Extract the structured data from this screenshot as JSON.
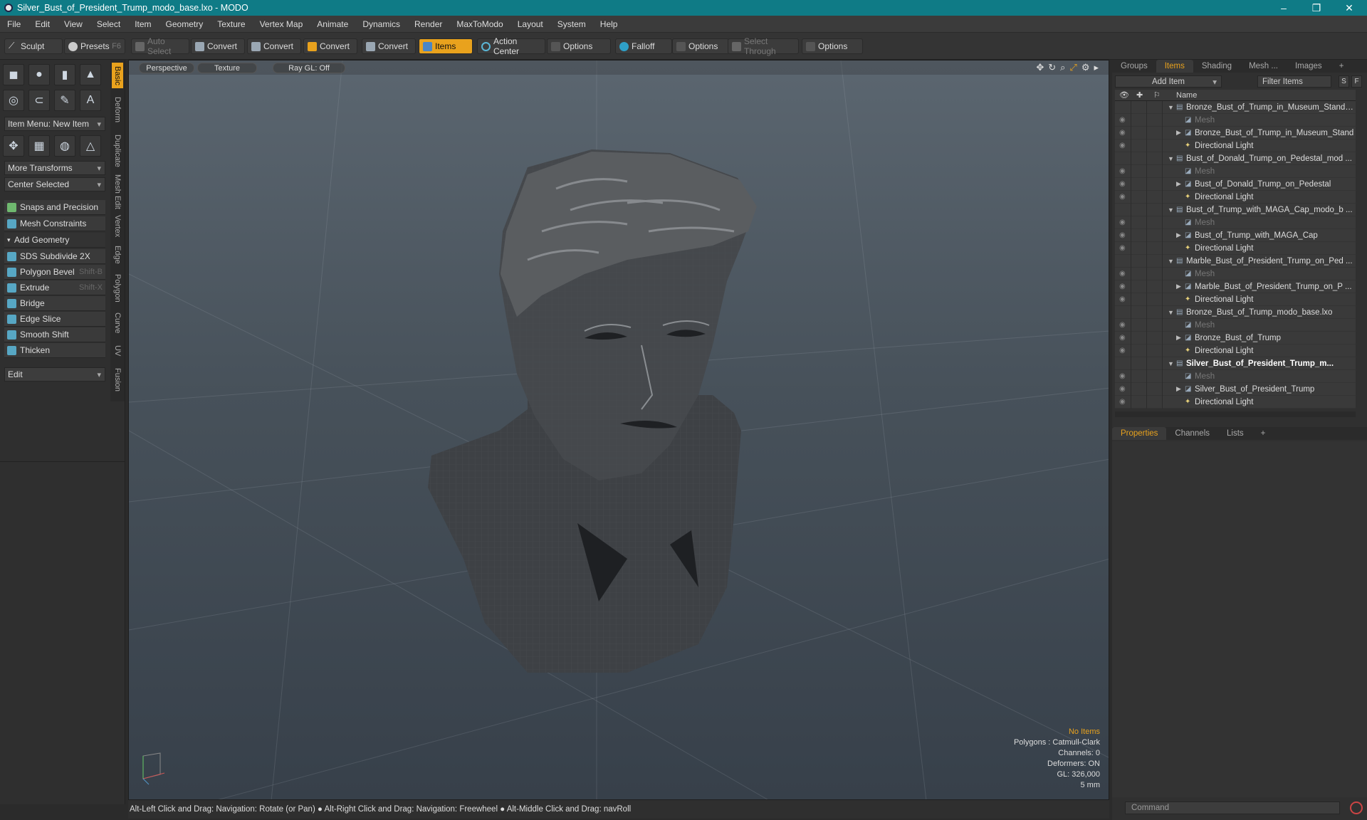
{
  "window": {
    "title": "Silver_Bust_of_President_Trump_modo_base.lxo - MODO"
  },
  "menu": [
    "File",
    "Edit",
    "View",
    "Select",
    "Item",
    "Geometry",
    "Texture",
    "Vertex Map",
    "Animate",
    "Dynamics",
    "Render",
    "MaxToModo",
    "Layout",
    "System",
    "Help"
  ],
  "toolbar": {
    "sculpt": "Sculpt",
    "presets": "Presets",
    "presets_shortcut": "F6",
    "auto_select": "Auto Select",
    "convert1": "Convert",
    "convert2": "Convert",
    "convert3": "Convert",
    "convert4": "Convert",
    "items": "Items",
    "action_center": "Action Center",
    "options1": "Options",
    "falloff": "Falloff",
    "options2": "Options",
    "select_through": "Select Through",
    "options3": "Options"
  },
  "left": {
    "item_menu": "Item Menu: New Item",
    "more_transforms": "More Transforms",
    "center_selected": "Center Selected",
    "snaps": "Snaps and Precision",
    "mesh_constraints": "Mesh Constraints",
    "add_geometry": "Add Geometry",
    "tools": [
      {
        "label": "SDS Subdivide 2X",
        "shortcut": ""
      },
      {
        "label": "Polygon Bevel",
        "shortcut": "Shift-B"
      },
      {
        "label": "Extrude",
        "shortcut": "Shift-X"
      },
      {
        "label": "Bridge",
        "shortcut": ""
      },
      {
        "label": "Edge Slice",
        "shortcut": ""
      },
      {
        "label": "Smooth Shift",
        "shortcut": ""
      },
      {
        "label": "Thicken",
        "shortcut": ""
      }
    ],
    "edit": "Edit",
    "vtabs": [
      "Basic",
      "Deform",
      "Duplicate",
      "Mesh Edit",
      "Vertex",
      "Edge",
      "Polygon",
      "Curve",
      "UV",
      "Fusion"
    ]
  },
  "viewport": {
    "perspective": "Perspective",
    "texture": "Texture",
    "raygl": "Ray GL: Off",
    "info": {
      "no_items": "No Items",
      "polygons": "Polygons : Catmull-Clark",
      "channels": "Channels: 0",
      "deformers": "Deformers: ON",
      "gl": "GL: 326,000",
      "scale": "5 mm"
    }
  },
  "status": "Alt-Left Click and Drag: Navigation: Rotate (or Pan) ● Alt-Right Click and Drag: Navigation: Freewheel ● Alt-Middle Click and Drag: navRoll",
  "right": {
    "tabs": [
      "Groups",
      "Items",
      "Shading",
      "Mesh ...",
      "Images"
    ],
    "add_item": "Add Item",
    "filter": "Filter Items",
    "s_btn": "S",
    "f_btn": "F",
    "name_header": "Name",
    "tree": [
      {
        "label": "Bronze_Bust_of_Trump_in_Museum_Stand ...",
        "level": 0,
        "type": "scene"
      },
      {
        "label": "Mesh",
        "level": 1,
        "type": "mesh"
      },
      {
        "label": "Bronze_Bust_of_Trump_in_Museum_Stand",
        "level": 1,
        "type": "group"
      },
      {
        "label": "Directional Light",
        "level": 1,
        "type": "light"
      },
      {
        "label": "Bust_of_Donald_Trump_on_Pedestal_mod ...",
        "level": 0,
        "type": "scene"
      },
      {
        "label": "Mesh",
        "level": 1,
        "type": "mesh"
      },
      {
        "label": "Bust_of_Donald_Trump_on_Pedestal",
        "level": 1,
        "type": "group"
      },
      {
        "label": "Directional Light",
        "level": 1,
        "type": "light"
      },
      {
        "label": "Bust_of_Trump_with_MAGA_Cap_modo_b ...",
        "level": 0,
        "type": "scene"
      },
      {
        "label": "Mesh",
        "level": 1,
        "type": "mesh"
      },
      {
        "label": "Bust_of_Trump_with_MAGA_Cap",
        "level": 1,
        "type": "group"
      },
      {
        "label": "Directional Light",
        "level": 1,
        "type": "light"
      },
      {
        "label": "Marble_Bust_of_President_Trump_on_Ped ...",
        "level": 0,
        "type": "scene"
      },
      {
        "label": "Mesh",
        "level": 1,
        "type": "mesh"
      },
      {
        "label": "Marble_Bust_of_President_Trump_on_P ...",
        "level": 1,
        "type": "group"
      },
      {
        "label": "Directional Light",
        "level": 1,
        "type": "light"
      },
      {
        "label": "Bronze_Bust_of_Trump_modo_base.lxo",
        "level": 0,
        "type": "scene"
      },
      {
        "label": "Mesh",
        "level": 1,
        "type": "mesh"
      },
      {
        "label": "Bronze_Bust_of_Trump",
        "level": 1,
        "type": "group"
      },
      {
        "label": "Directional Light",
        "level": 1,
        "type": "light"
      },
      {
        "label": "Silver_Bust_of_President_Trump_m...",
        "level": 0,
        "type": "scene",
        "bold": true
      },
      {
        "label": "Mesh",
        "level": 1,
        "type": "mesh"
      },
      {
        "label": "Silver_Bust_of_President_Trump",
        "level": 1,
        "type": "group"
      },
      {
        "label": "Directional Light",
        "level": 1,
        "type": "light"
      }
    ],
    "bottom_tabs": [
      "Properties",
      "Channels",
      "Lists"
    ],
    "command_placeholder": "Command"
  }
}
